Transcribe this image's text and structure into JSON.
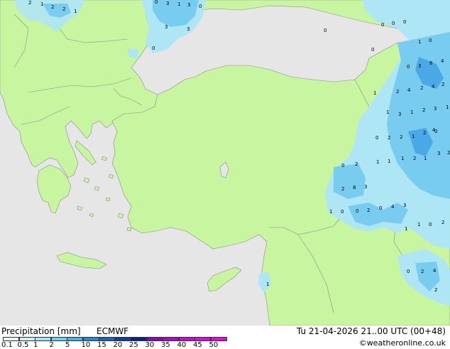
{
  "footer": {
    "title": "Precipitation [mm]",
    "model": "ECMWF",
    "valid_time": "Tu 21-04-2026 21..00 UTC (00+48)",
    "credit": "©weatheronline.co.uk"
  },
  "legend": {
    "ticks": [
      "0.1",
      "0.5",
      "1",
      "2",
      "5",
      "10",
      "15",
      "20",
      "25",
      "30",
      "35",
      "40",
      "45",
      "50"
    ],
    "colors": [
      "#e8fafa",
      "#c8f0fa",
      "#a0e6fa",
      "#64d2fa",
      "#3cb4f0",
      "#1e8cdc",
      "#1464c8",
      "#0a3caa",
      "#0a1e8c",
      "#8c00c8",
      "#b400dc",
      "#d200e6",
      "#e600f0",
      "#f000f0"
    ]
  },
  "map": {
    "colors": {
      "sea": "#e6e6e6",
      "land": "#c8f5a0",
      "border": "#8c8c8c",
      "precip_light": "#aee6f5",
      "precip_mid": "#78ccf0",
      "precip_heavy": "#4aa8e6"
    },
    "labels": [
      {
        "t": "2"
      },
      {
        "t": "1"
      },
      {
        "t": "2"
      },
      {
        "t": "2"
      },
      {
        "t": "1"
      },
      {
        "t": "0"
      },
      {
        "t": "3"
      },
      {
        "t": "1"
      },
      {
        "t": "3"
      },
      {
        "t": "0"
      },
      {
        "t": "3"
      },
      {
        "t": "3"
      },
      {
        "t": "0"
      },
      {
        "t": "0"
      },
      {
        "t": "0"
      },
      {
        "t": "0"
      },
      {
        "t": "0"
      },
      {
        "t": "0"
      },
      {
        "t": "1"
      },
      {
        "t": "0"
      },
      {
        "t": "3"
      },
      {
        "t": "8"
      },
      {
        "t": "4"
      },
      {
        "t": "0"
      },
      {
        "t": "1"
      },
      {
        "t": "2"
      },
      {
        "t": "4"
      },
      {
        "t": "2"
      },
      {
        "t": "4"
      },
      {
        "t": "2"
      },
      {
        "t": "1"
      },
      {
        "t": "3"
      },
      {
        "t": "1"
      },
      {
        "t": "2"
      },
      {
        "t": "3"
      },
      {
        "t": "1"
      },
      {
        "t": "4"
      },
      {
        "t": "0"
      },
      {
        "t": "2"
      },
      {
        "t": "2"
      },
      {
        "t": "1"
      },
      {
        "t": "2"
      },
      {
        "t": "0"
      },
      {
        "t": "1"
      },
      {
        "t": "1"
      },
      {
        "t": "1"
      },
      {
        "t": "2"
      },
      {
        "t": "1"
      },
      {
        "t": "3"
      },
      {
        "t": "2"
      },
      {
        "t": "0"
      },
      {
        "t": "2"
      },
      {
        "t": "2"
      },
      {
        "t": "8"
      },
      {
        "t": "3"
      },
      {
        "t": "1"
      },
      {
        "t": "0"
      },
      {
        "t": "0"
      },
      {
        "t": "2"
      },
      {
        "t": "0"
      },
      {
        "t": "4"
      },
      {
        "t": "3"
      },
      {
        "t": "1"
      },
      {
        "t": "1"
      },
      {
        "t": "0"
      },
      {
        "t": "2"
      },
      {
        "t": "0"
      },
      {
        "t": "2"
      },
      {
        "t": "4"
      },
      {
        "t": "2"
      },
      {
        "t": "1"
      }
    ]
  }
}
